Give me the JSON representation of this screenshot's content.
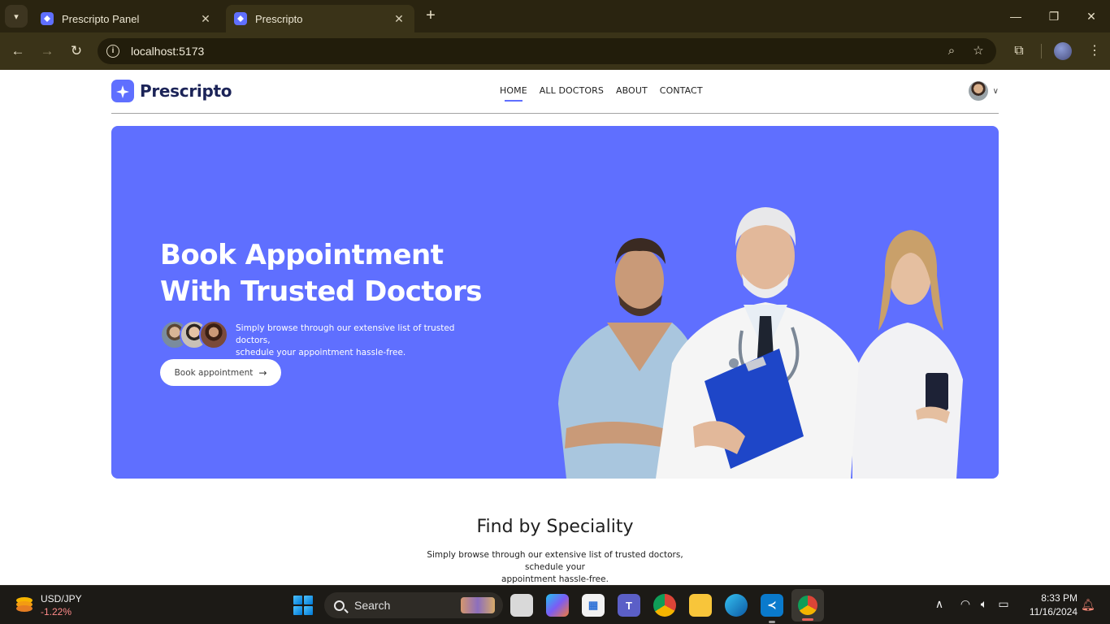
{
  "browser": {
    "tabs": [
      {
        "title": "Prescripto Panel",
        "active": false
      },
      {
        "title": "Prescripto",
        "active": true
      }
    ],
    "url": "localhost:5173"
  },
  "site": {
    "logo_text": "Prescripto",
    "nav_links": [
      "HOME",
      "ALL DOCTORS",
      "ABOUT",
      "CONTACT"
    ],
    "active_nav": "HOME",
    "brand_color": "#5f6fff"
  },
  "hero": {
    "title_line1": "Book Appointment",
    "title_line2": "With Trusted Doctors",
    "description_line1": "Simply browse through our extensive list of trusted doctors,",
    "description_line2": "schedule your appointment hassle-free.",
    "cta_label": "Book appointment",
    "cta_icon": "arrow-right-icon"
  },
  "speciality": {
    "title": "Find by Speciality",
    "description_line1": "Simply browse through our extensive list of trusted doctors, schedule your",
    "description_line2": "appointment hassle-free."
  },
  "taskbar": {
    "widget_pair": "USD/JPY",
    "widget_change": "-1.22%",
    "search_placeholder": "Search",
    "time": "8:33 PM",
    "date": "11/16/2024"
  }
}
